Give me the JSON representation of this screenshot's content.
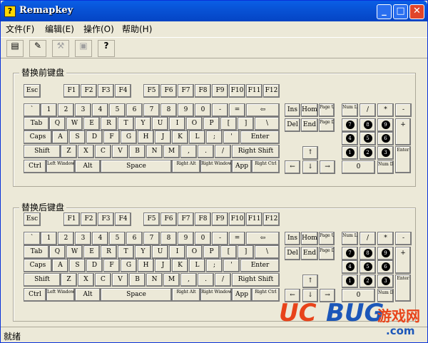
{
  "app": {
    "title": "Remapkey",
    "icon": "?"
  },
  "menu": [
    "文件(F)",
    "编辑(E)",
    "操作(O)",
    "帮助(H)"
  ],
  "toolbar": [
    {
      "name": "open-keyboard-icon",
      "glyph": "▤",
      "enabled": true
    },
    {
      "name": "undo-icon",
      "glyph": "✎",
      "enabled": true
    },
    {
      "name": "save-icon",
      "glyph": "⚒",
      "enabled": false
    },
    {
      "name": "reset-icon",
      "glyph": "▣",
      "enabled": false
    },
    {
      "name": "help-icon",
      "glyph": "?",
      "enabled": true
    }
  ],
  "sections": {
    "before": "替换前键盘",
    "after": "替换后键盘"
  },
  "status": "就绪",
  "watermark": {
    "uc": "UC",
    "bug": "BUG",
    "cn": "游戏网",
    ".com": ".com"
  },
  "colors": {
    "title_bar": "#0853d6",
    "close": "#e0452b",
    "accent": "#e8431a",
    "brand": "#1c57b9"
  },
  "keys": [
    [
      "Esc"
    ],
    [
      "F1",
      "F2",
      "F3",
      "F4"
    ],
    [
      "F5",
      "F6",
      "F7",
      "F8"
    ],
    [
      "F9",
      "F10",
      "F11",
      "F12"
    ],
    [
      "`",
      "1",
      "2",
      "3",
      "4",
      "5",
      "6",
      "7",
      "8",
      "9",
      "0",
      "-",
      "=",
      "⇦"
    ],
    [
      "Tab",
      "Q",
      "W",
      "E",
      "R",
      "T",
      "Y",
      "U",
      "I",
      "O",
      "P",
      "[",
      "]",
      "\\"
    ],
    [
      "Caps",
      "A",
      "S",
      "D",
      "F",
      "G",
      "H",
      "J",
      "K",
      "L",
      ";",
      "'",
      "Enter"
    ],
    [
      "Shift",
      "Z",
      "X",
      "C",
      "V",
      "B",
      "N",
      "M",
      ",",
      ".",
      "/",
      "Right Shift"
    ],
    [
      "Ctrl",
      "Left Windows",
      "Alt",
      "Space",
      "Right Alt",
      "Right Windows",
      "App",
      "Right Ctrl"
    ],
    [
      "Ins",
      "Home",
      "Page Up",
      "Del",
      "End",
      "Page Down"
    ],
    [
      "↑",
      "←",
      "↓",
      "→"
    ],
    [
      "Num Lock",
      "/",
      "*",
      "-",
      "7",
      "8",
      "9",
      "+",
      "4",
      "5",
      "6",
      "1",
      "2",
      "3",
      "Enter",
      "0",
      "Num Del"
    ]
  ]
}
